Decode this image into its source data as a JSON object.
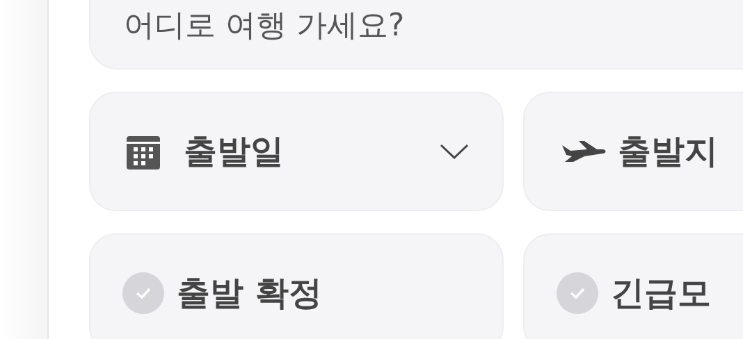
{
  "search": {
    "placeholder": "어디로 여행 가세요?"
  },
  "filters": [
    {
      "kind": "select",
      "label": "출발일",
      "chevron": true
    },
    {
      "kind": "select",
      "label": "출발지",
      "chevron": false
    },
    {
      "kind": "check",
      "label": "출발 확정",
      "checked": false
    },
    {
      "kind": "check",
      "label": "긴급모",
      "checked": false
    }
  ]
}
